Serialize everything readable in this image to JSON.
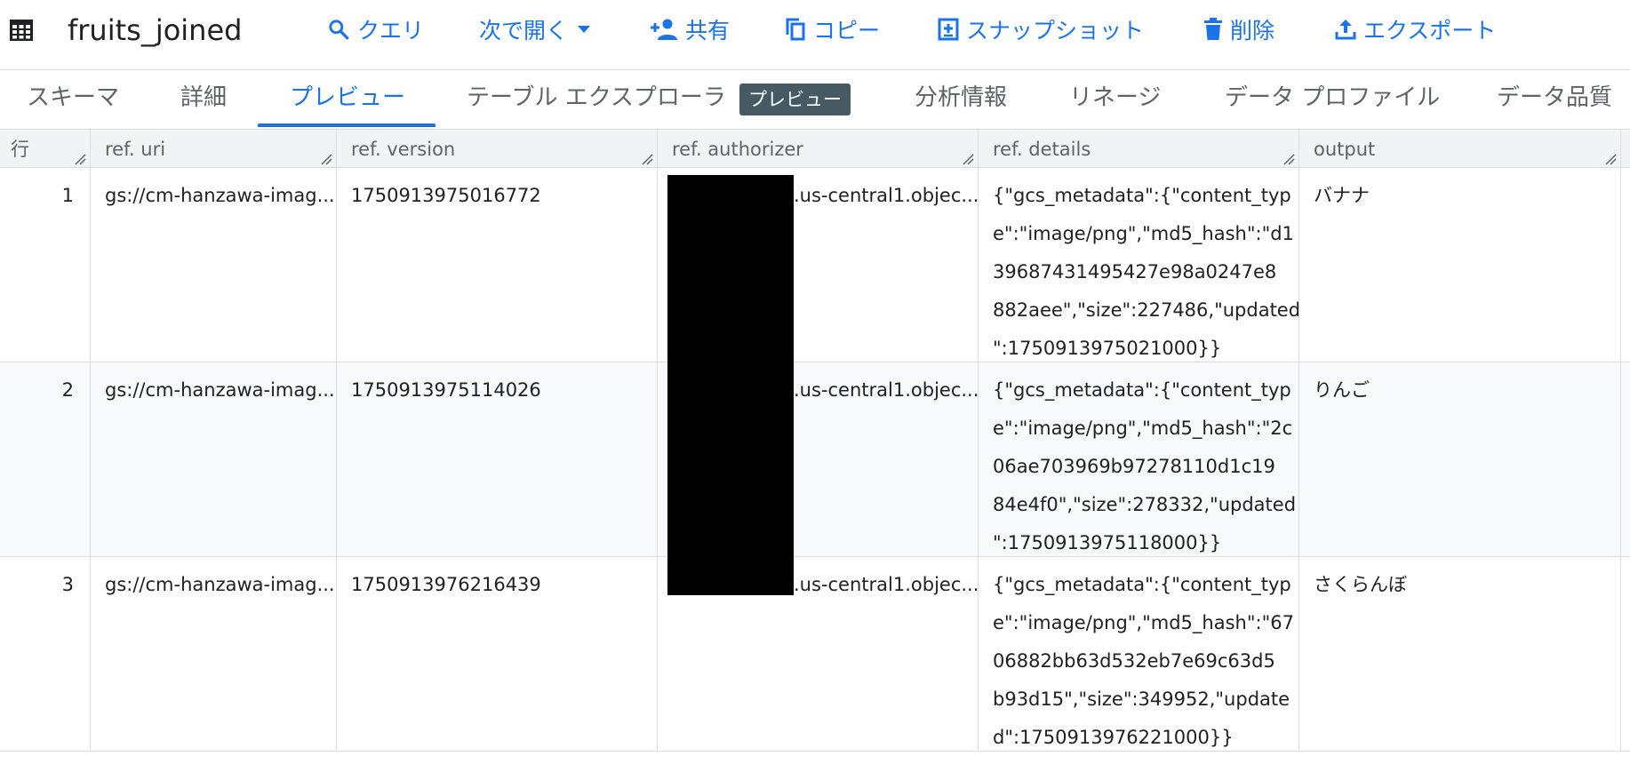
{
  "toolbar": {
    "table_name": "fruits_joined",
    "buttons": [
      {
        "id": "query",
        "label": "クエリ",
        "icon": "search-icon"
      },
      {
        "id": "open",
        "label": "次で開く",
        "icon": "caret-down-icon"
      },
      {
        "id": "share",
        "label": "共有",
        "icon": "person-add-icon"
      },
      {
        "id": "copy",
        "label": "コピー",
        "icon": "copy-icon"
      },
      {
        "id": "snapshot",
        "label": "スナップショット",
        "icon": "snapshot-icon"
      },
      {
        "id": "delete",
        "label": "削除",
        "icon": "trash-icon"
      },
      {
        "id": "export",
        "label": "エクスポート",
        "icon": "upload-icon"
      }
    ],
    "accent_color": "#1a73e8"
  },
  "tabs": [
    {
      "label": "スキーマ",
      "active": false
    },
    {
      "label": "詳細",
      "active": false
    },
    {
      "label": "プレビュー",
      "active": true
    },
    {
      "label": "テーブル エクスプローラ",
      "active": false,
      "badge": "プレビュー"
    },
    {
      "label": "分析情報",
      "active": false
    },
    {
      "label": "リネージ",
      "active": false
    },
    {
      "label": "データ プロファイル",
      "active": false
    },
    {
      "label": "データ品質",
      "active": false
    }
  ],
  "table": {
    "columns": [
      "行",
      "ref. uri",
      "ref. version",
      "ref. authorizer",
      "ref. details",
      "output"
    ],
    "rows": [
      {
        "row": "1",
        "uri": "gs://cm-hanzawa-imag...",
        "version": "1750913975016772",
        "authorizer": ".us-central1.objec...",
        "details": [
          "{\"gcs_metadata\":{\"content_typ",
          "e\":\"image/png\",\"md5_hash\":\"d1",
          "39687431495427e98a0247e8",
          "882aee\",\"size\":227486,\"updated",
          "\":1750913975021000}}"
        ],
        "output": "バナナ"
      },
      {
        "row": "2",
        "uri": "gs://cm-hanzawa-imag...",
        "version": "1750913975114026",
        "authorizer": ".us-central1.objec...",
        "details": [
          "{\"gcs_metadata\":{\"content_typ",
          "e\":\"image/png\",\"md5_hash\":\"2c",
          "06ae703969b97278110d1c19",
          "84e4f0\",\"size\":278332,\"updated",
          "\":1750913975118000}}"
        ],
        "output": "りんご"
      },
      {
        "row": "3",
        "uri": "gs://cm-hanzawa-imag...",
        "version": "1750913976216439",
        "authorizer": ".us-central1.objec...",
        "details": [
          "{\"gcs_metadata\":{\"content_typ",
          "e\":\"image/png\",\"md5_hash\":\"67",
          "06882bb63d532eb7e69c63d5",
          "b93d15\",\"size\":349952,\"update",
          "d\":1750913976221000}}"
        ],
        "output": "さくらんぼ"
      }
    ]
  }
}
